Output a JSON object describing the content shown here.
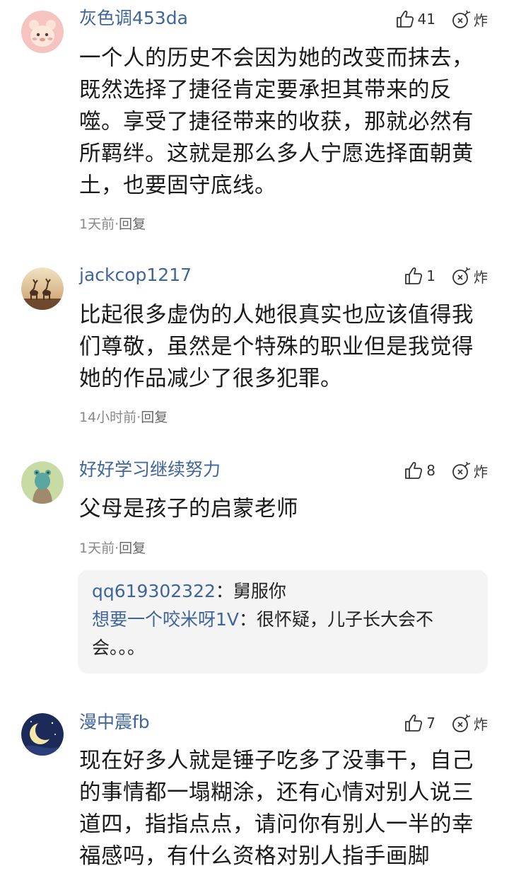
{
  "comments": [
    {
      "username": "灰色调453da",
      "likes": "41",
      "bomb_label": "炸",
      "text": "一个人的历史不会因为她的改变而抹去，既然选择了捷径肯定要承担其带来的反噬。享受了捷径带来的收获，那就必然有所羁绊。这就是那么多人宁愿选择面朝黄土，也要固守底线。",
      "time": "1天前",
      "reply_label": "回复"
    },
    {
      "username": "jackcop1217",
      "likes": "1",
      "bomb_label": "炸",
      "text": "比起很多虚伪的人她很真实也应该值得我们尊敬，虽然是个特殊的职业但是我觉得她的作品减少了很多犯罪。",
      "time": "14小时前",
      "reply_label": "回复"
    },
    {
      "username": "好好学习继续努力",
      "likes": "8",
      "bomb_label": "炸",
      "text": "父母是孩子的启蒙老师",
      "time": "1天前",
      "reply_label": "回复",
      "replies": [
        {
          "name": "qq619302322",
          "sep": "：",
          "text": "舅服你"
        },
        {
          "name": "想要一个咬米呀1V",
          "sep": "：",
          "text": "很怀疑，儿子长大会不会。。。"
        }
      ]
    },
    {
      "username": "漫中震fb",
      "likes": "7",
      "bomb_label": "炸",
      "text": "现在好多人就是锤子吃多了没事干，自己的事情都一塌糊涂，还有心情对别人说三道四，指指点点，请问你有别人一半的幸福感吗，有什么资格对别人指手画脚"
    }
  ],
  "meta_separator": "·",
  "icons": {
    "like": "thumbs-up-icon",
    "bomb": "bomb-icon"
  },
  "colors": {
    "username": "#406599",
    "meta": "#888888",
    "reply_bg": "#f4f4f4"
  }
}
